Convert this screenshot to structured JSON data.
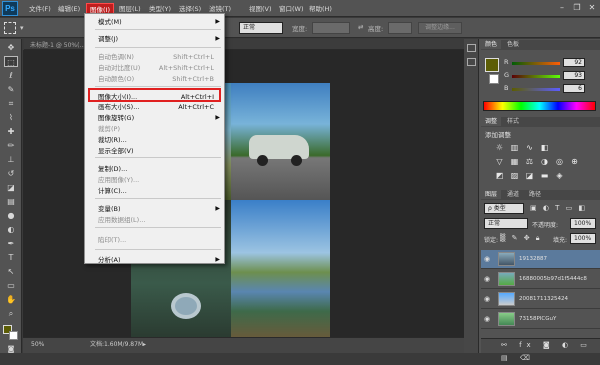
{
  "app": {
    "logo": "Ps"
  },
  "menubar": {
    "items": [
      "文件(F)",
      "编辑(E)",
      "图像(I)",
      "图层(L)",
      "类型(Y)",
      "选择(S)",
      "滤镜(T)",
      "视图(V)",
      "窗口(W)",
      "帮助(H)"
    ],
    "active_index": 2
  },
  "window_controls": {
    "minimize": "–",
    "restore": "❐",
    "close": "✕"
  },
  "options": {
    "mode_value": "正常",
    "width_label": "宽度:",
    "height_label": "高度:",
    "refine_button": "调整边缘..."
  },
  "document": {
    "tab_title": "未标题-1 @ 50%(...",
    "zoom": "50%",
    "doc_info": "文档:1.60M/9.87M"
  },
  "image_menu": {
    "items": [
      {
        "label": "模式(M)",
        "submenu": true,
        "disabled": false
      },
      {
        "label": "调整(J)",
        "submenu": true,
        "disabled": false
      },
      {
        "label": "自动色调(N)",
        "shortcut": "Shift+Ctrl+L",
        "disabled": true
      },
      {
        "label": "自动对比度(U)",
        "shortcut": "Alt+Shift+Ctrl+L",
        "disabled": true
      },
      {
        "label": "自动颜色(O)",
        "shortcut": "Shift+Ctrl+B",
        "disabled": true
      },
      {
        "label": "图像大小(I)...",
        "shortcut": "Alt+Ctrl+I",
        "disabled": false,
        "highlighted": true
      },
      {
        "label": "画布大小(S)...",
        "shortcut": "Alt+Ctrl+C",
        "disabled": false
      },
      {
        "label": "图像旋转(G)",
        "submenu": true,
        "disabled": false
      },
      {
        "label": "裁剪(P)",
        "disabled": true
      },
      {
        "label": "裁切(R)...",
        "disabled": false
      },
      {
        "label": "显示全部(V)",
        "disabled": false
      },
      {
        "label": "复制(D)...",
        "disabled": false
      },
      {
        "label": "应用图像(Y)...",
        "disabled": true
      },
      {
        "label": "计算(C)...",
        "disabled": false
      },
      {
        "label": "变量(B)",
        "submenu": true,
        "disabled": false
      },
      {
        "label": "应用数据组(L)...",
        "disabled": true
      },
      {
        "label": "陷印(T)...",
        "disabled": true
      },
      {
        "label": "分析(A)",
        "submenu": true,
        "disabled": false
      }
    ]
  },
  "color_panel": {
    "tabs": [
      "颜色",
      "色板"
    ],
    "channels": [
      {
        "label": "R",
        "value": "92"
      },
      {
        "label": "G",
        "value": "93"
      },
      {
        "label": "B",
        "value": "6"
      }
    ],
    "foreground": "#5c5d06"
  },
  "adjust_panel": {
    "tabs": [
      "调整",
      "样式"
    ],
    "title": "添加调整"
  },
  "layers_panel": {
    "tabs": [
      "图层",
      "通道",
      "路径"
    ],
    "kind_label": "ρ 类型",
    "blend_mode": "正常",
    "opacity_label": "不透明度:",
    "opacity_value": "100%",
    "lock_label": "锁定:",
    "fill_label": "填充:",
    "fill_value": "100%",
    "layers": [
      "19132887",
      "16880005b97d1f5444c8",
      "20081711325424",
      "73158PICGuY"
    ]
  },
  "colors": {
    "menu_highlight": "#c01e1e",
    "layer_selected": "#5b7a9c"
  }
}
